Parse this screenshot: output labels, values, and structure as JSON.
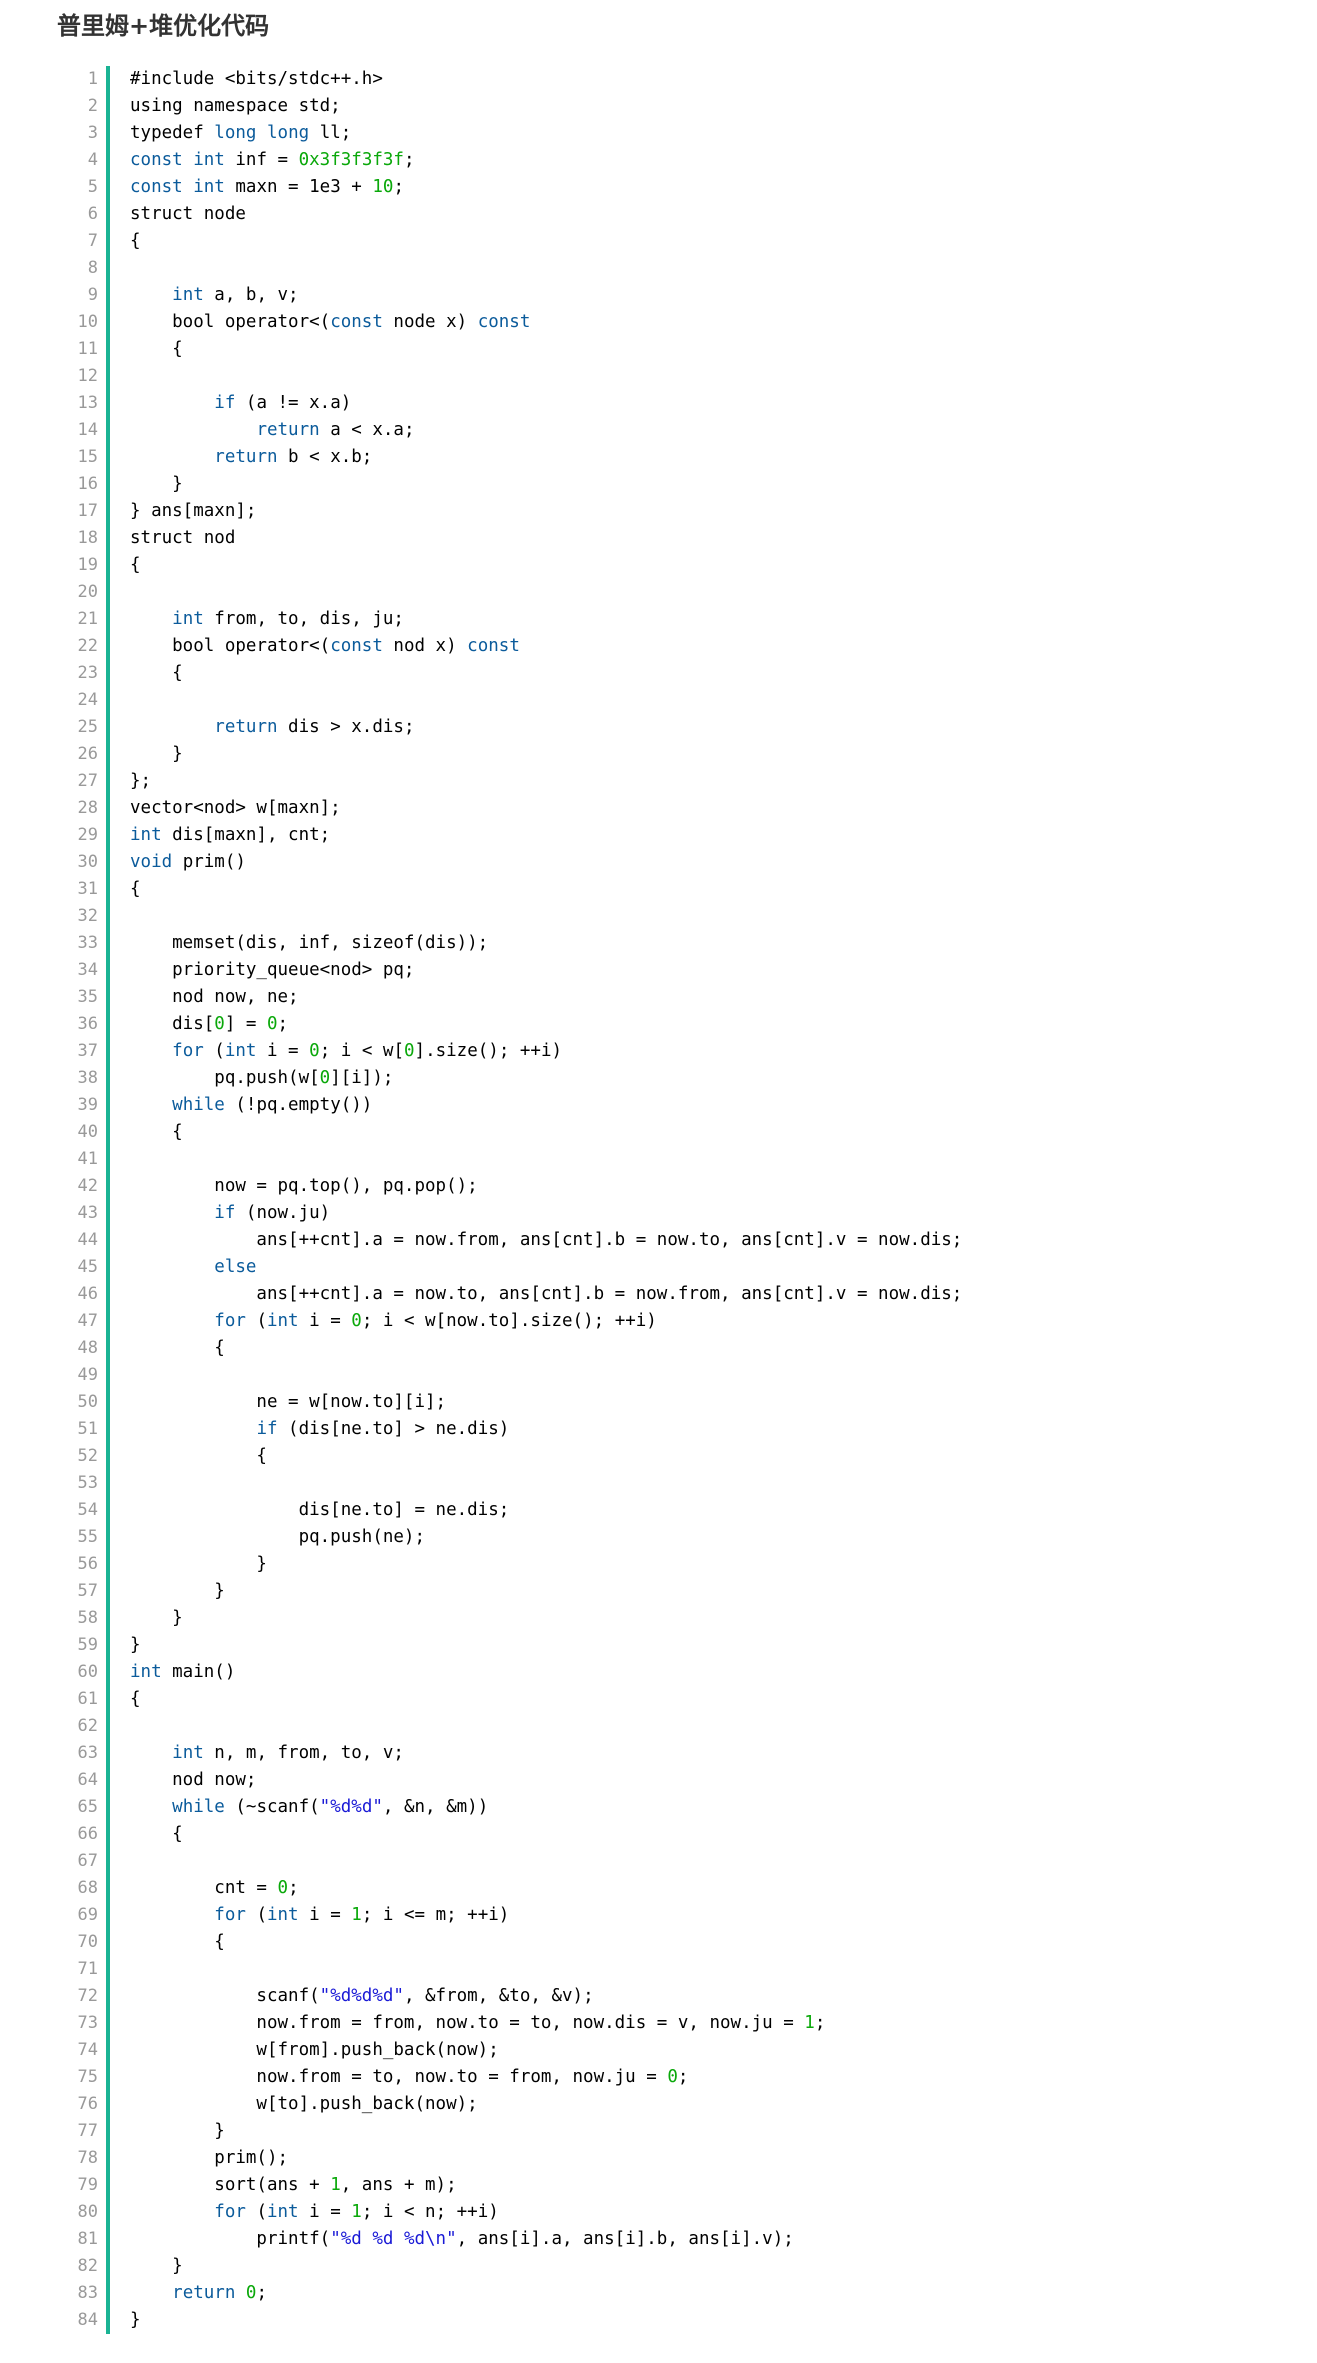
{
  "title": "普里姆+堆优化代码",
  "colors": {
    "accent_bar": "#1ab394",
    "keyword": "#0b5b9b",
    "number": "#0aa80a",
    "string": "#1a1ad6",
    "line_number": "#999999"
  },
  "code": {
    "lines": [
      "#include <bits/stdc++.h>",
      "using namespace std;",
      "typedef long long ll;",
      "const int inf = 0x3f3f3f3f;",
      "const int maxn = 1e3 + 10;",
      "struct node",
      "{",
      "",
      "    int a, b, v;",
      "    bool operator<(const node x) const",
      "    {",
      "",
      "        if (a != x.a)",
      "            return a < x.a;",
      "        return b < x.b;",
      "    }",
      "} ans[maxn];",
      "struct nod",
      "{",
      "",
      "    int from, to, dis, ju;",
      "    bool operator<(const nod x) const",
      "    {",
      "",
      "        return dis > x.dis;",
      "    }",
      "};",
      "vector<nod> w[maxn];",
      "int dis[maxn], cnt;",
      "void prim()",
      "{",
      "",
      "    memset(dis, inf, sizeof(dis));",
      "    priority_queue<nod> pq;",
      "    nod now, ne;",
      "    dis[0] = 0;",
      "    for (int i = 0; i < w[0].size(); ++i)",
      "        pq.push(w[0][i]);",
      "    while (!pq.empty())",
      "    {",
      "",
      "        now = pq.top(), pq.pop();",
      "        if (now.ju)",
      "            ans[++cnt].a = now.from, ans[cnt].b = now.to, ans[cnt].v = now.dis;",
      "        else",
      "            ans[++cnt].a = now.to, ans[cnt].b = now.from, ans[cnt].v = now.dis;",
      "        for (int i = 0; i < w[now.to].size(); ++i)",
      "        {",
      "",
      "            ne = w[now.to][i];",
      "            if (dis[ne.to] > ne.dis)",
      "            {",
      "",
      "                dis[ne.to] = ne.dis;",
      "                pq.push(ne);",
      "            }",
      "        }",
      "    }",
      "}",
      "int main()",
      "{",
      "",
      "    int n, m, from, to, v;",
      "    nod now;",
      "    while (~scanf(\"%d%d\", &n, &m))",
      "    {",
      "",
      "        cnt = 0;",
      "        for (int i = 1; i <= m; ++i)",
      "        {",
      "",
      "            scanf(\"%d%d%d\", &from, &to, &v);",
      "            now.from = from, now.to = to, now.dis = v, now.ju = 1;",
      "            w[from].push_back(now);",
      "            now.from = to, now.to = from, now.ju = 0;",
      "            w[to].push_back(now);",
      "        }",
      "        prim();",
      "        sort(ans + 1, ans + m);",
      "        for (int i = 1; i < n; ++i)",
      "            printf(\"%d %d %d\\n\", ans[i].a, ans[i].b, ans[i].v);",
      "    }",
      "    return 0;",
      "}"
    ]
  }
}
